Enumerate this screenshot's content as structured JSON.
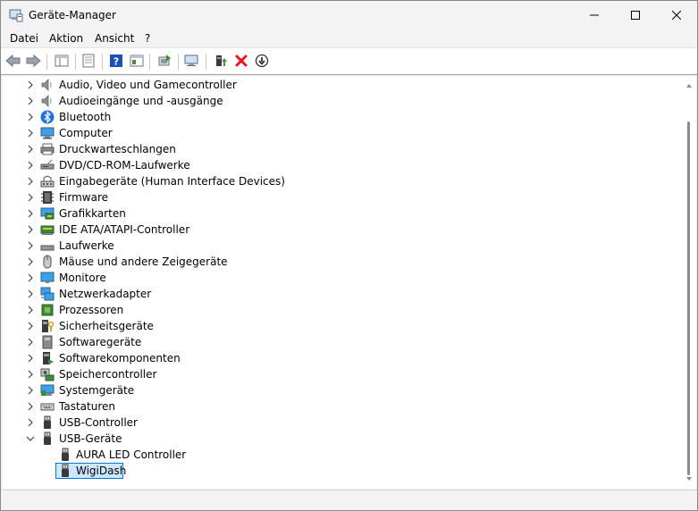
{
  "window": {
    "title": "Geräte-Manager",
    "app_icon": "device-manager-icon"
  },
  "menu": [
    "Datei",
    "Aktion",
    "Ansicht",
    "?"
  ],
  "toolbar": {
    "buttons": [
      "back-arrow-icon",
      "forward-arrow-icon",
      "show-hide-console-tree-icon",
      "properties-icon",
      "help-icon",
      "view-icon",
      "update-driver-icon",
      "scan-hardware-icon",
      "enable-device-icon",
      "uninstall-device-icon",
      "disable-device-icon"
    ]
  },
  "tree": {
    "categories": [
      {
        "label": "Audio, Video und Gamecontroller",
        "icon": "speaker-icon"
      },
      {
        "label": "Audioeingänge und -ausgänge",
        "icon": "speaker-icon"
      },
      {
        "label": "Bluetooth",
        "icon": "bluetooth-icon"
      },
      {
        "label": "Computer",
        "icon": "computer-icon"
      },
      {
        "label": "Druckwarteschlangen",
        "icon": "printer-icon"
      },
      {
        "label": "DVD/CD-ROM-Laufwerke",
        "icon": "dvd-drive-icon"
      },
      {
        "label": "Eingabegeräte (Human Interface Devices)",
        "icon": "hid-icon"
      },
      {
        "label": "Firmware",
        "icon": "firmware-icon"
      },
      {
        "label": "Grafikkarten",
        "icon": "display-adapter-icon"
      },
      {
        "label": "IDE ATA/ATAPI-Controller",
        "icon": "ide-controller-icon"
      },
      {
        "label": "Laufwerke",
        "icon": "disk-drive-icon"
      },
      {
        "label": "Mäuse und andere Zeigegeräte",
        "icon": "mouse-icon"
      },
      {
        "label": "Monitore",
        "icon": "monitor-icon"
      },
      {
        "label": "Netzwerkadapter",
        "icon": "network-adapter-icon"
      },
      {
        "label": "Prozessoren",
        "icon": "processor-icon"
      },
      {
        "label": "Sicherheitsgeräte",
        "icon": "security-device-icon"
      },
      {
        "label": "Softwaregeräte",
        "icon": "software-device-icon"
      },
      {
        "label": "Softwarekomponenten",
        "icon": "software-component-icon"
      },
      {
        "label": "Speichercontroller",
        "icon": "storage-controller-icon"
      },
      {
        "label": "Systemgeräte",
        "icon": "system-device-icon"
      },
      {
        "label": "Tastaturen",
        "icon": "keyboard-icon"
      },
      {
        "label": "USB-Controller",
        "icon": "usb-icon"
      },
      {
        "label": "USB-Geräte",
        "icon": "usb-icon",
        "expanded": true
      }
    ],
    "children": [
      {
        "label": "AURA LED Controller",
        "icon": "usb-icon"
      },
      {
        "label": "WigiDash",
        "icon": "usb-icon",
        "selected": true
      }
    ]
  },
  "colors": {
    "selection_bg": "#cce8ff",
    "selection_border": "#0078d7",
    "delete_red": "#e81123",
    "help_blue": "#1e50b4"
  }
}
